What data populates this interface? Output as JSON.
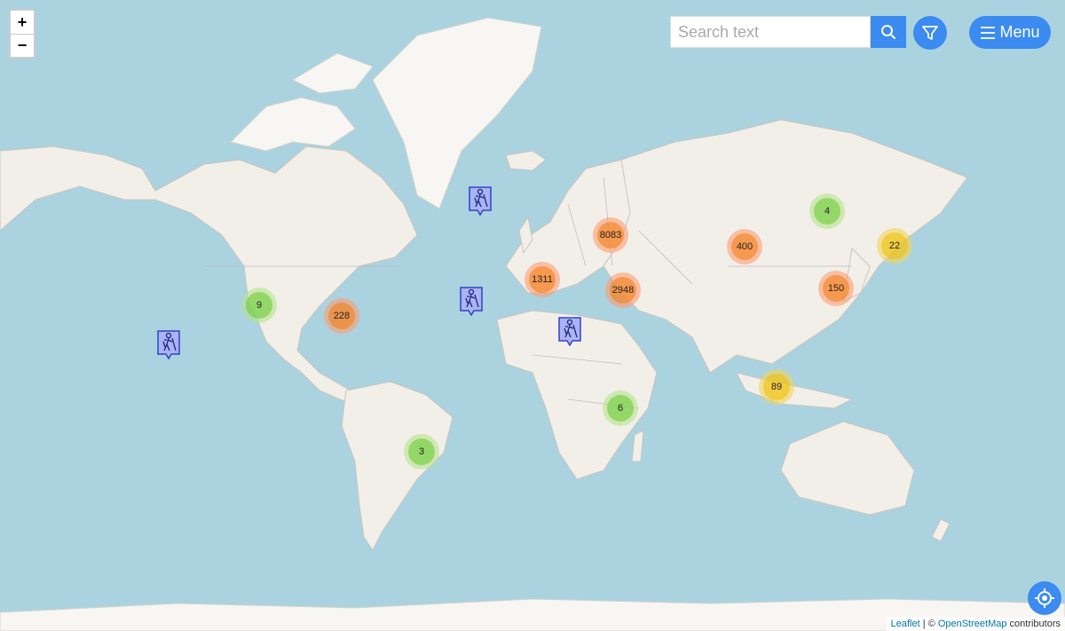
{
  "zoom": {
    "in_label": "+",
    "out_label": "−"
  },
  "search": {
    "placeholder": "Search text",
    "value": ""
  },
  "menu": {
    "label": "Menu"
  },
  "colors": {
    "accent": "#3b8bf0",
    "water": "#aad3df",
    "land": "#f2efe9",
    "marker": "#3242c8"
  },
  "clusters": [
    {
      "label": "8083",
      "size": "large"
    },
    {
      "label": "400",
      "size": "large"
    },
    {
      "label": "4",
      "size": "small"
    },
    {
      "label": "22",
      "size": "medium"
    },
    {
      "label": "1311",
      "size": "large"
    },
    {
      "label": "2948",
      "size": "large"
    },
    {
      "label": "150",
      "size": "large"
    },
    {
      "label": "9",
      "size": "small"
    },
    {
      "label": "228",
      "size": "large"
    },
    {
      "label": "89",
      "size": "medium"
    },
    {
      "label": "6",
      "size": "small"
    },
    {
      "label": "3",
      "size": "small"
    }
  ],
  "markers": {
    "icon": "hiker-icon",
    "count": 4
  },
  "attribution": {
    "leaflet": "Leaflet",
    "separator": " | © ",
    "osm": "OpenStreetMap",
    "suffix": " contributors"
  }
}
